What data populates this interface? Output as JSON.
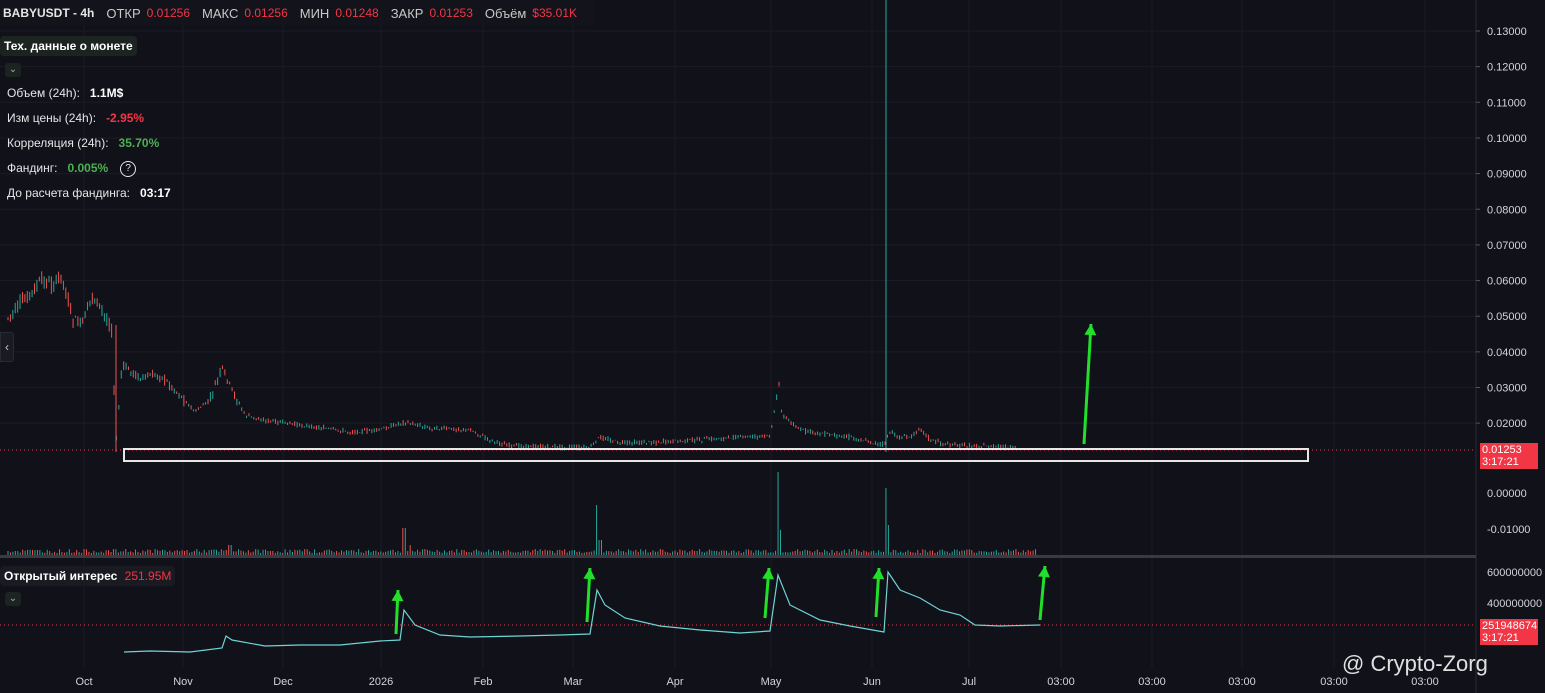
{
  "header": {
    "symbol": "BABYUSDT - 4h",
    "open_label": "ОТКР",
    "open": "0.01256",
    "high_label": "МАКС",
    "high": "0.01256",
    "low_label": "МИН",
    "low": "0.01248",
    "close_label": "ЗАКР",
    "close": "0.01253",
    "volume_label": "Объём",
    "volume": "$35.01K"
  },
  "info_panel": {
    "title": "Тех. данные о монете",
    "volume_label": "Объем (24h):",
    "volume": "1.1M$",
    "price_change_label": "Изм цены (24h):",
    "price_change": "-2.95%",
    "correlation_label": "Корреляция (24h):",
    "correlation": "35.70%",
    "funding_label": "Фандинг:",
    "funding": "0.005%",
    "funding_help": "?",
    "funding_timer_label": "До расчета фандинга:",
    "funding_timer": "03:17"
  },
  "oi_panel": {
    "title": "Открытый интерес",
    "value": "251.95M"
  },
  "price_axis": {
    "ticks": [
      "0.13000",
      "0.12000",
      "0.11000",
      "0.10000",
      "0.09000",
      "0.08000",
      "0.07000",
      "0.06000",
      "0.05000",
      "0.04000",
      "0.03000",
      "0.02000"
    ],
    "ticks_values": [
      0.13,
      0.12,
      0.11,
      0.1,
      0.09,
      0.08,
      0.07,
      0.06,
      0.05,
      0.04,
      0.03,
      0.02
    ],
    "current_price": "0.01253",
    "countdown": "3:17:21"
  },
  "volume_axis": {
    "ticks": [
      "0.00000",
      "-0.01000"
    ]
  },
  "oi_axis": {
    "ticks": [
      "600000000",
      "400000000"
    ],
    "current": "251948674",
    "countdown": "3:17:21"
  },
  "time_axis": {
    "labels": [
      "Oct",
      "Nov",
      "Dec",
      "2026",
      "Feb",
      "Mar",
      "Apr",
      "May",
      "Jun",
      "Jul",
      "03:00",
      "03:00",
      "03:00",
      "03:00",
      "03:00"
    ]
  },
  "colors": {
    "up": "#26a69a",
    "down": "#ef5350",
    "arrow": "#22e02a",
    "oi_line": "#6fd4d4",
    "price_line": "#f23645",
    "panel_bg": "#11111a"
  },
  "watermark": "@ Crypto-Zorg",
  "left_handle_icon": "chevron-left-icon",
  "chart_data": {
    "type": "line",
    "title": "",
    "price_series": {
      "x": [
        "Oct",
        "Oct",
        "Nov",
        "Nov",
        "Dec",
        "2026",
        "Feb",
        "Mar",
        "Apr",
        "May",
        "May",
        "Jun",
        "Jun",
        "Jul"
      ],
      "y": [
        0.052,
        0.062,
        0.035,
        0.036,
        0.019,
        0.02,
        0.014,
        0.016,
        0.016,
        0.031,
        0.018,
        0.135,
        0.018,
        0.013
      ]
    },
    "open_interest_series": {
      "x": [
        "Oct",
        "Nov",
        "Nov",
        "Dec",
        "2026",
        "Feb",
        "Mar",
        "Apr",
        "May",
        "Jun",
        "Jul"
      ],
      "y": [
        130000000,
        150000000,
        220000000,
        190000000,
        400000000,
        230000000,
        520000000,
        260000000,
        620000000,
        610000000,
        252000000
      ]
    },
    "ylim": [
      0.01,
      0.135
    ]
  }
}
